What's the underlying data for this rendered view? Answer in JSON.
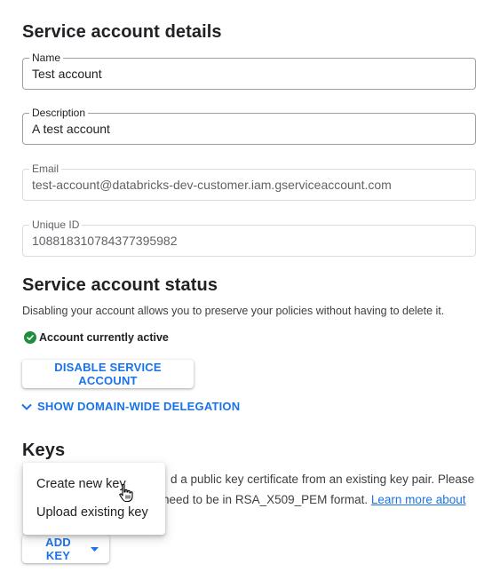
{
  "details": {
    "title": "Service account details",
    "name": {
      "label": "Name",
      "value": "Test account"
    },
    "description": {
      "label": "Description",
      "value": "A test account"
    },
    "email": {
      "label": "Email",
      "value": "test-account@databricks-dev-customer.iam.gserviceaccount.com"
    },
    "unique_id": {
      "label": "Unique ID",
      "value": "108818310784377395982"
    }
  },
  "status": {
    "title": "Service account status",
    "description": "Disabling your account allows you to preserve your policies without having to delete it.",
    "state_label": "Account currently active",
    "disable_button": "DISABLE SERVICE ACCOUNT",
    "delegation_link": "SHOW DOMAIN-WIDE DELEGATION"
  },
  "keys": {
    "title": "Keys",
    "desc_line1_visible": "d a public key certificate from an existing key pair. Please",
    "desc_line2_visible": "need to be in RSA_X509_PEM format.",
    "learn_more_link": "Learn more about",
    "add_key_button": "ADD KEY",
    "menu": [
      "Create new key",
      "Upload existing key"
    ]
  },
  "colors": {
    "accent": "#1a73e8",
    "success": "#1e8e3e"
  }
}
